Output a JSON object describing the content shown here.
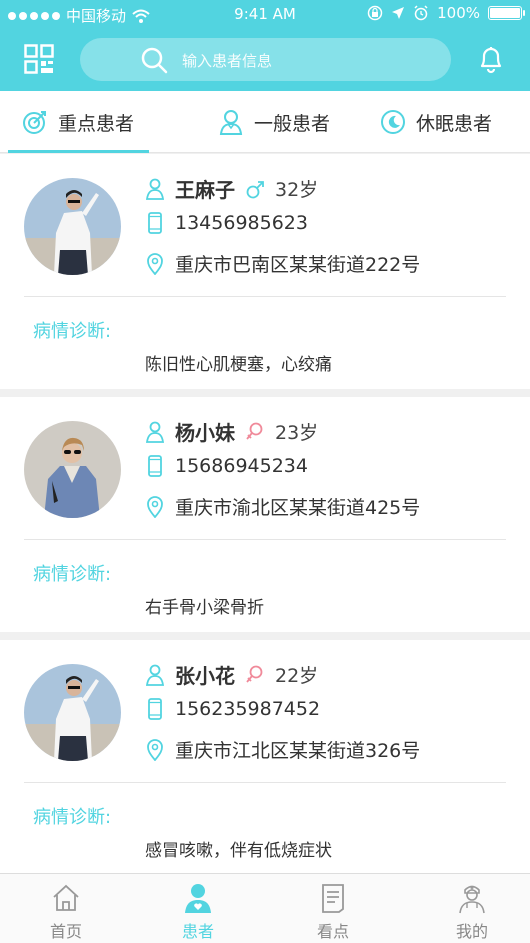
{
  "status_bar": {
    "carrier": "中国移动",
    "time": "9:41 AM",
    "battery": "100%"
  },
  "search": {
    "placeholder": "输入患者信息"
  },
  "tabs": [
    {
      "label": "重点患者",
      "icon": "target-icon",
      "active": true
    },
    {
      "label": "一般患者",
      "icon": "person-icon",
      "active": false
    },
    {
      "label": "休眠患者",
      "icon": "moon-icon",
      "active": false
    }
  ],
  "patients": [
    {
      "name": "王麻子",
      "gender": "male",
      "age": "32岁",
      "phone": "13456985623",
      "address": "重庆市巴南区某某街道222号",
      "diagnosis_label": "病情诊断:",
      "diagnosis": "陈旧性心肌梗塞，心绞痛"
    },
    {
      "name": "杨小妹",
      "gender": "female",
      "age": "23岁",
      "phone": "15686945234",
      "address": "重庆市渝北区某某街道425号",
      "diagnosis_label": "病情诊断:",
      "diagnosis": "右手骨小梁骨折"
    },
    {
      "name": "张小花",
      "gender": "female",
      "age": "22岁",
      "phone": "156235987452",
      "address": "重庆市江北区某某街道326号",
      "diagnosis_label": "病情诊断:",
      "diagnosis": "感冒咳嗽，伴有低烧症状"
    }
  ],
  "nav": [
    {
      "label": "首页",
      "icon": "home-icon",
      "active": false
    },
    {
      "label": "患者",
      "icon": "patient-icon",
      "active": true
    },
    {
      "label": "看点",
      "icon": "document-icon",
      "active": false
    },
    {
      "label": "我的",
      "icon": "doctor-icon",
      "active": false
    }
  ],
  "colors": {
    "accent": "#52d4e0",
    "female": "#f08a9a",
    "text": "#333333"
  }
}
